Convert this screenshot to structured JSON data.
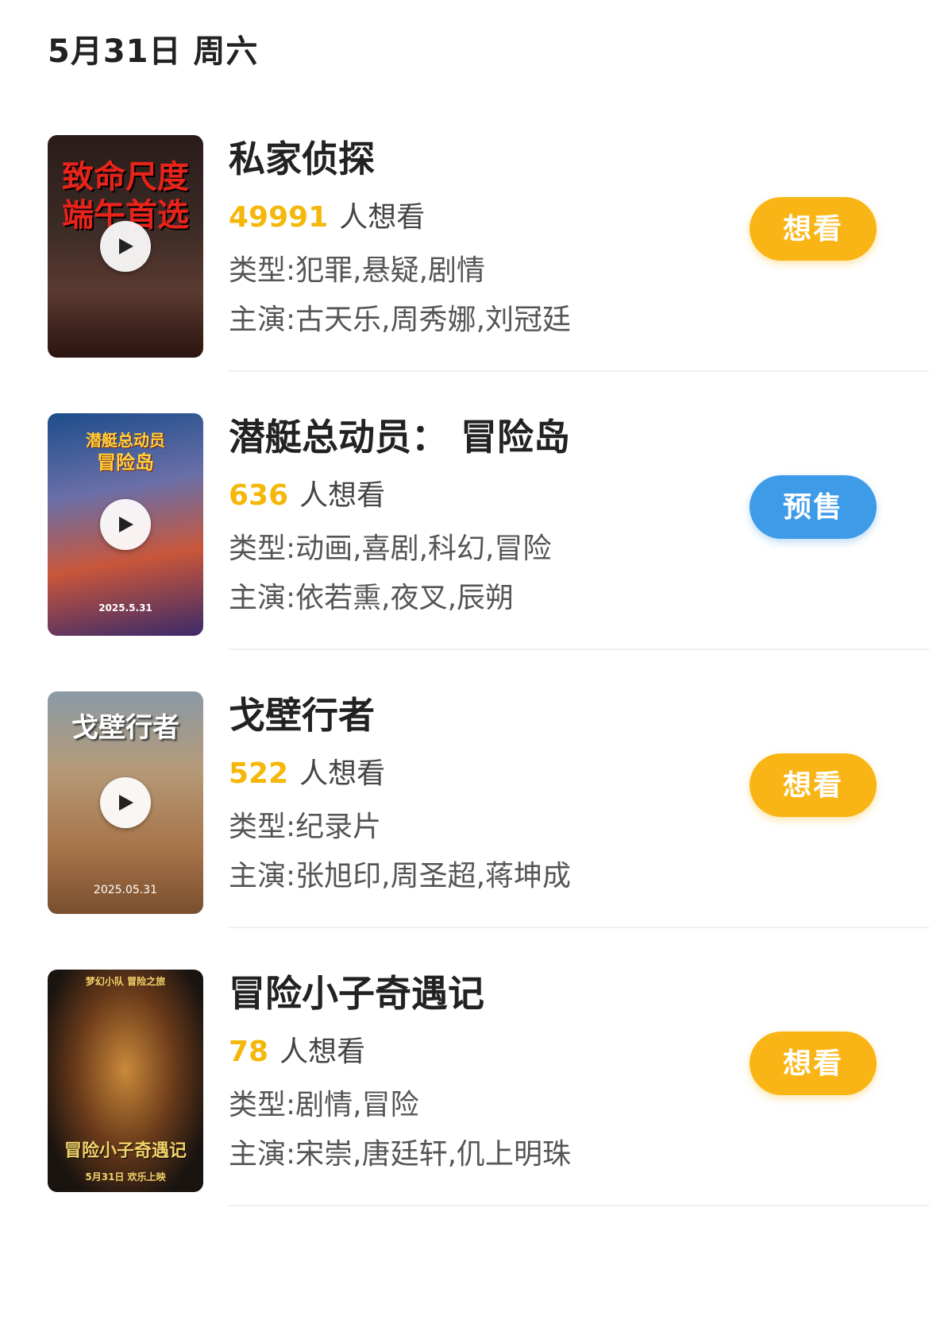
{
  "date_header": "5月31日 周六",
  "colors": {
    "want_button": "#f9b515",
    "presale_button": "#3e9be8",
    "wish_count": "#f5b70a"
  },
  "movies": [
    {
      "title": "私家侦探",
      "wish_count": "49991",
      "wish_label": "人想看",
      "genre": "类型:犯罪,悬疑,剧情",
      "cast": "主演:古天乐,周秀娜,刘冠廷",
      "action": "想看",
      "action_type": "want",
      "poster_text": "致命尺度",
      "poster_text2": "端午首选",
      "play_icon": "play-icon"
    },
    {
      "title": "潜艇总动员： 冒险岛",
      "wish_count": "636",
      "wish_label": "人想看",
      "genre": "类型:动画,喜剧,科幻,冒险",
      "cast": "主演:依若熏,夜叉,辰朔",
      "action": "预售",
      "action_type": "presale",
      "poster_text": "潜艇总动员",
      "poster_text2": "冒险岛",
      "poster_date": "2025.5.31",
      "play_icon": "play-icon"
    },
    {
      "title": "戈壁行者",
      "wish_count": "522",
      "wish_label": "人想看",
      "genre": "类型:纪录片",
      "cast": "主演:张旭印,周圣超,蒋坤成",
      "action": "想看",
      "action_type": "want",
      "poster_text": "戈壁行者",
      "poster_date": "2025.05.31",
      "play_icon": "play-icon"
    },
    {
      "title": "冒险小子奇遇记",
      "wish_count": "78",
      "wish_label": "人想看",
      "genre": "类型:剧情,冒险",
      "cast": "主演:宋崇,唐廷轩,仉上明珠",
      "action": "想看",
      "action_type": "want",
      "poster_text": "冒险小子奇遇记",
      "poster_top": "梦幻小队  冒险之旅",
      "poster_date": "5月31日 欢乐上映",
      "play_icon": "play-icon"
    }
  ]
}
